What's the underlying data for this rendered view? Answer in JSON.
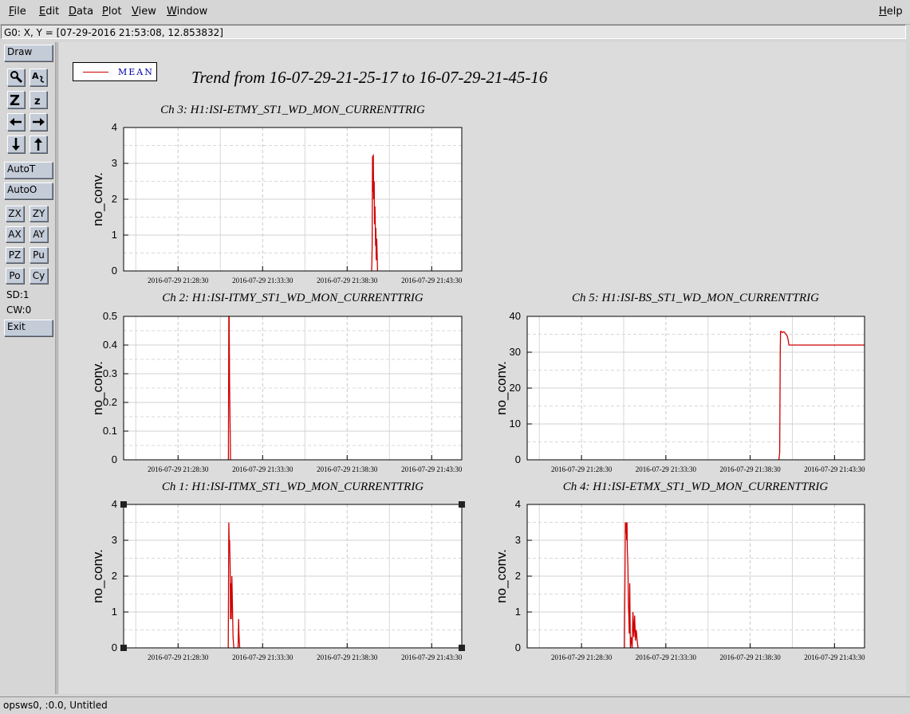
{
  "menubar": {
    "items": [
      "File",
      "Edit",
      "Data",
      "Plot",
      "View",
      "Window"
    ],
    "help": "Help"
  },
  "coord_readout": "G0: X, Y = [07-29-2016 21:53:08, 12.853832]",
  "toolbar": {
    "draw": "Draw",
    "icons": [
      "magnify-icon",
      "label-icon",
      "zoom-big-icon",
      "zoom-small-icon",
      "arrow-left-icon",
      "arrow-right-icon",
      "arrow-down-icon",
      "arrow-up-icon"
    ],
    "icon_glyphs": {
      "zoom_big": "Z",
      "zoom_small": "z",
      "label": "A"
    },
    "autot": "AutoT",
    "autoo": "AutoO",
    "small_buttons": [
      "ZX",
      "ZY",
      "AX",
      "AY",
      "PZ",
      "Pu",
      "Po",
      "Cy"
    ],
    "sd": "SD:1",
    "cw": "CW:0",
    "exit": "Exit"
  },
  "legend": {
    "label": "MEAN",
    "color": "#d00000"
  },
  "main_title": "Trend from 16-07-29-21-25-17 to 16-07-29-21-45-16",
  "status_text": "opsws0, :0.0, Untitled",
  "chart_data": [
    {
      "type": "line",
      "title": "Ch 3: H1:ISI-ETMY_ST1_WD_MON_CURRENTTRIG",
      "ylabel": "no_conv.",
      "xticks": [
        "2016-07-29 21:28:30",
        "2016-07-29 21:33:30",
        "2016-07-29 21:38:30",
        "2016-07-29 21:43:30"
      ],
      "yticks": [
        "0",
        "1",
        "2",
        "3",
        "4"
      ],
      "ylim": [
        0,
        4
      ],
      "xlim_minutes": [
        -3.22,
        16.78
      ],
      "grid": true,
      "series": [
        {
          "name": "MEAN",
          "color": "#d00000",
          "x": [
            11.45,
            11.48,
            11.5,
            11.52,
            11.55,
            11.57,
            11.6,
            11.62,
            11.65,
            11.68,
            11.7,
            11.72,
            11.75,
            11.8
          ],
          "y": [
            0,
            0.6,
            3.2,
            2.2,
            3.25,
            2.0,
            2.5,
            1.3,
            1.8,
            0.7,
            1.2,
            0.3,
            0.9,
            0
          ]
        }
      ]
    },
    {
      "type": "line",
      "title": "Ch 2: H1:ISI-ITMY_ST1_WD_MON_CURRENTTRIG",
      "ylabel": "no_conv.",
      "xticks": [
        "2016-07-29 21:28:30",
        "2016-07-29 21:33:30",
        "2016-07-29 21:38:30",
        "2016-07-29 21:43:30"
      ],
      "yticks": [
        "0",
        "0.1",
        "0.2",
        "0.3",
        "0.4",
        "0.5"
      ],
      "ylim": [
        0,
        0.5
      ],
      "xlim_minutes": [
        -3.22,
        16.78
      ],
      "grid": true,
      "series": [
        {
          "name": "MEAN",
          "color": "#d00000",
          "x": [
            2.98,
            3.0,
            3.02,
            3.05,
            3.08,
            3.1
          ],
          "y": [
            0,
            0.5,
            0.5,
            0.25,
            0.1,
            0
          ]
        }
      ]
    },
    {
      "type": "line",
      "title": "Ch 5: H1:ISI-BS_ST1_WD_MON_CURRENTTRIG",
      "ylabel": "no_conv.",
      "xticks": [
        "2016-07-29 21:28:30",
        "2016-07-29 21:33:30",
        "2016-07-29 21:38:30",
        "2016-07-29 21:43:30"
      ],
      "yticks": [
        "0",
        "10",
        "20",
        "30",
        "40"
      ],
      "ylim": [
        0,
        40
      ],
      "xlim_minutes": [
        -3.22,
        16.78
      ],
      "grid": true,
      "series": [
        {
          "name": "MEAN",
          "color": "#d00000",
          "x": [
            11.7,
            11.75,
            11.78,
            11.8,
            11.85,
            11.9,
            12.0,
            12.1,
            12.2,
            12.25,
            12.3,
            12.4,
            16.78
          ],
          "y": [
            0,
            2,
            30,
            35.8,
            35.8,
            35.5,
            35.7,
            35.2,
            34.5,
            33.5,
            32,
            32,
            32
          ]
        }
      ]
    },
    {
      "type": "line",
      "title": "Ch 1: H1:ISI-ITMX_ST1_WD_MON_CURRENTTRIG",
      "ylabel": "no_conv.",
      "xticks": [
        "2016-07-29 21:28:30",
        "2016-07-29 21:33:30",
        "2016-07-29 21:38:30",
        "2016-07-29 21:43:30"
      ],
      "yticks": [
        "0",
        "1",
        "2",
        "3",
        "4"
      ],
      "ylim": [
        0,
        4
      ],
      "xlim_minutes": [
        -3.22,
        16.78
      ],
      "grid": true,
      "series": [
        {
          "name": "MEAN",
          "color": "#d00000",
          "x": [
            2.97,
            3.0,
            3.03,
            3.05,
            3.08,
            3.1,
            3.12,
            3.15,
            3.18,
            3.2,
            3.25,
            3.3,
            3.5,
            3.55,
            3.58,
            3.6,
            3.62,
            3.65
          ],
          "y": [
            0,
            3.5,
            2.8,
            3.0,
            2.2,
            0.8,
            1.8,
            0.8,
            2.0,
            1.6,
            0.3,
            0,
            0,
            0,
            0.8,
            0.4,
            0.2,
            0
          ]
        }
      ]
    },
    {
      "type": "line",
      "title": "Ch 4: H1:ISI-ETMX_ST1_WD_MON_CURRENTTRIG",
      "ylabel": "no_conv.",
      "xticks": [
        "2016-07-29 21:28:30",
        "2016-07-29 21:33:30",
        "2016-07-29 21:38:30",
        "2016-07-29 21:43:30"
      ],
      "yticks": [
        "0",
        "1",
        "2",
        "3",
        "4"
      ],
      "ylim": [
        0,
        4
      ],
      "xlim_minutes": [
        -3.22,
        16.78
      ],
      "grid": true,
      "series": [
        {
          "name": "MEAN",
          "color": "#d00000",
          "x": [
            2.55,
            2.6,
            2.62,
            2.65,
            2.68,
            2.7,
            2.72,
            2.75,
            2.78,
            2.8,
            2.83,
            2.86,
            2.9,
            2.95,
            3.0,
            3.05,
            3.1,
            3.15,
            3.2,
            3.25,
            3.3,
            3.35
          ],
          "y": [
            0,
            3.5,
            3.2,
            3.5,
            3.0,
            3.5,
            2.7,
            2.3,
            1.2,
            1.0,
            0.4,
            1.8,
            0,
            0.3,
            0,
            1.0,
            0.3,
            0.9,
            0.2,
            0.5,
            0.2,
            0
          ]
        }
      ]
    }
  ]
}
